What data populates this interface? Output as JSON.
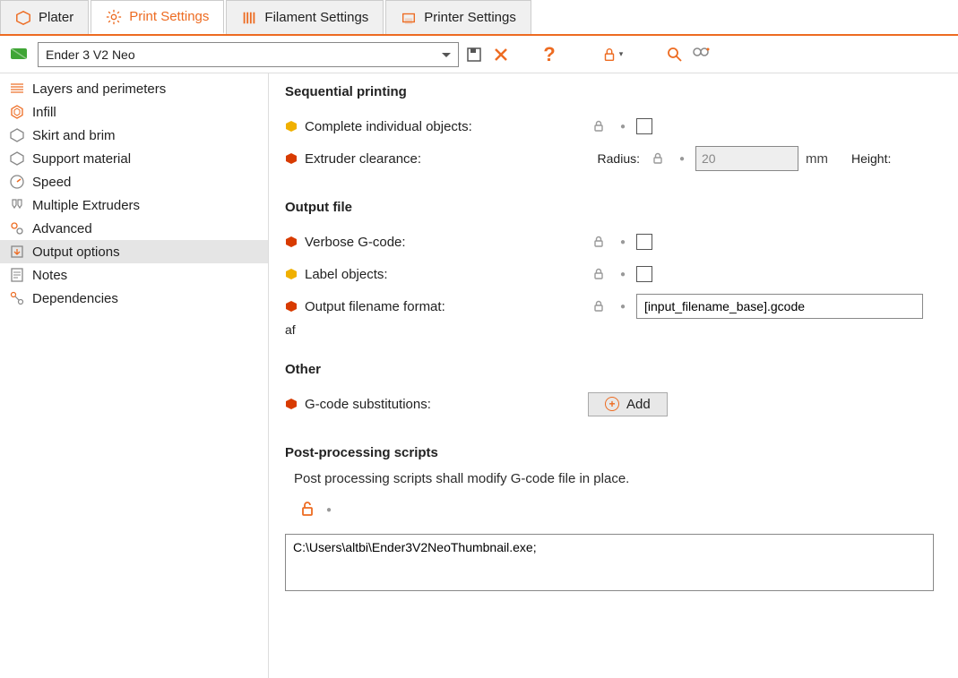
{
  "tabs": [
    {
      "label": "Plater"
    },
    {
      "label": "Print Settings"
    },
    {
      "label": "Filament Settings"
    },
    {
      "label": "Printer Settings"
    }
  ],
  "preset_name": "Ender 3 V2 Neo",
  "sidebar": {
    "items": [
      {
        "label": "Layers and perimeters"
      },
      {
        "label": "Infill"
      },
      {
        "label": "Skirt and brim"
      },
      {
        "label": "Support material"
      },
      {
        "label": "Speed"
      },
      {
        "label": "Multiple Extruders"
      },
      {
        "label": "Advanced"
      },
      {
        "label": "Output options"
      },
      {
        "label": "Notes"
      },
      {
        "label": "Dependencies"
      }
    ]
  },
  "sections": {
    "sequential": {
      "title": "Sequential printing",
      "complete_label": "Complete individual objects:",
      "clearance_label": "Extruder clearance:",
      "radius_label": "Radius:",
      "radius_value": "20",
      "radius_unit": "mm",
      "height_label": "Height:"
    },
    "output": {
      "title": "Output file",
      "verbose_label": "Verbose G-code:",
      "label_objects_label": "Label objects:",
      "filename_format_label": "Output filename format:",
      "filename_format_value": "[input_filename_base].gcode"
    },
    "other": {
      "title": "Other",
      "substitutions_label": "G-code substitutions:",
      "add_label": "Add"
    },
    "post": {
      "title": "Post-processing scripts",
      "note": "Post processing scripts shall modify G-code file in place.",
      "script_value": "C:\\Users\\altbi\\Ender3V2NeoThumbnail.exe;"
    }
  },
  "colors": {
    "accent": "#ed6b21",
    "bullet_yellow": "#f0b000",
    "bullet_red": "#d83b01"
  }
}
